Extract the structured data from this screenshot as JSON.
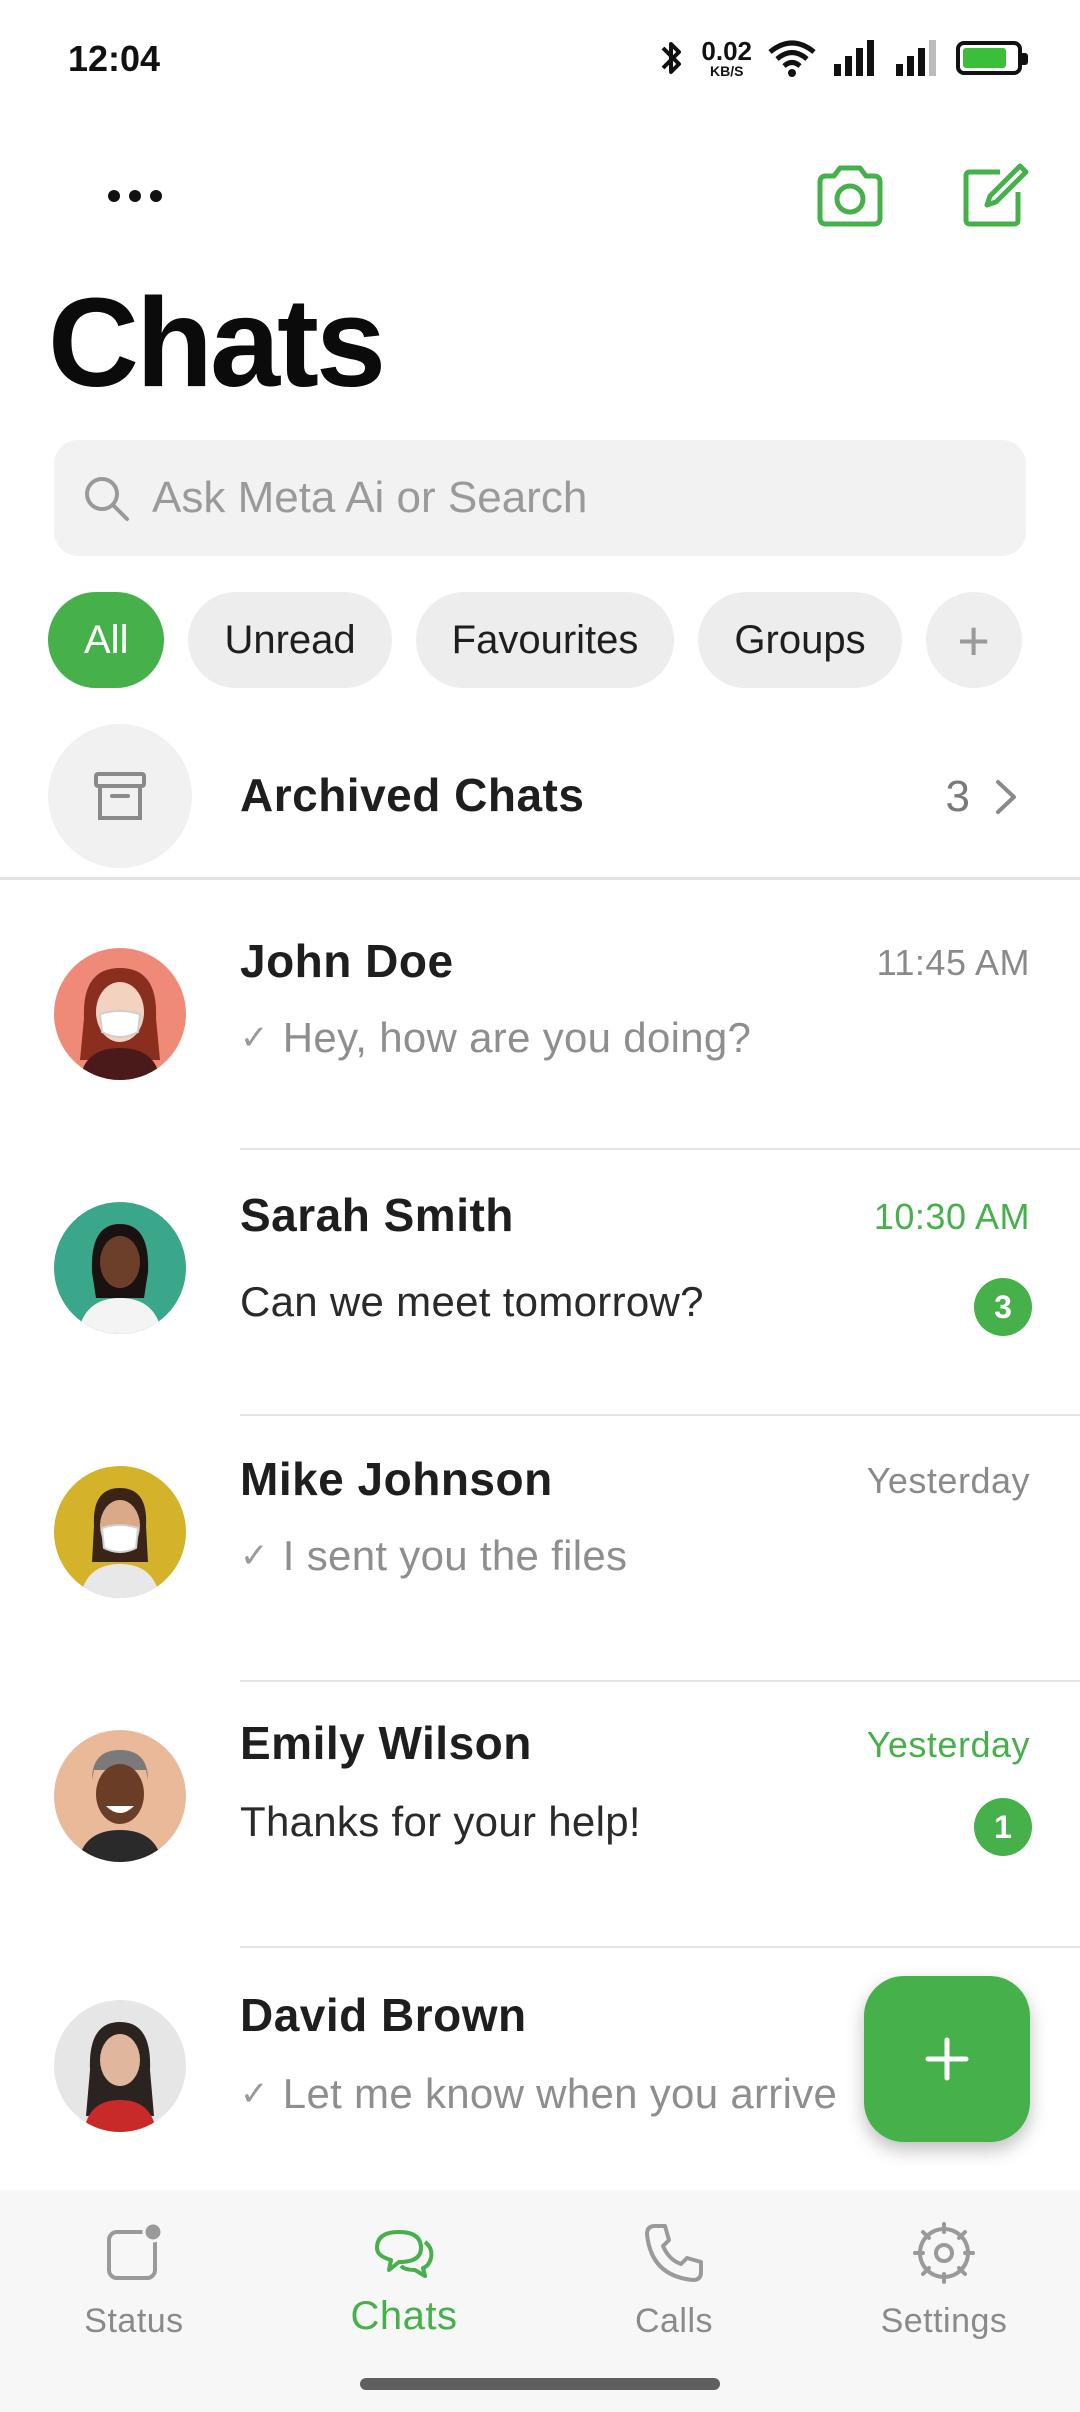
{
  "status_bar": {
    "time": "12:04",
    "net_speed_value": "0.02",
    "net_speed_unit": "KB/S",
    "battery_level": 0.85,
    "icons": [
      "bluetooth-icon",
      "wifi-icon",
      "signal-icon",
      "signal-icon-2",
      "battery-icon"
    ]
  },
  "header": {
    "title": "Chats",
    "more_icon": "more-icon",
    "camera_icon": "camera-icon",
    "compose_icon": "compose-icon"
  },
  "search": {
    "placeholder": "Ask Meta Ai or Search",
    "value": ""
  },
  "filters": [
    {
      "label": "All",
      "active": true
    },
    {
      "label": "Unread",
      "active": false
    },
    {
      "label": "Favourites",
      "active": false
    },
    {
      "label": "Groups",
      "active": false
    }
  ],
  "filters_add_label": "+",
  "archived": {
    "label": "Archived Chats",
    "count": "3"
  },
  "chats": [
    {
      "name": "John Doe",
      "time": "11:45 AM",
      "message": "Hey, how are you doing?",
      "read_tick": "✓",
      "unread_count": "",
      "unread": false
    },
    {
      "name": "Sarah Smith",
      "time": "10:30 AM",
      "message": "Can we meet tomorrow?",
      "read_tick": "",
      "unread_count": "3",
      "unread": true
    },
    {
      "name": "Mike Johnson",
      "time": "Yesterday",
      "message": "I sent you the files",
      "read_tick": "✓",
      "unread_count": "",
      "unread": false
    },
    {
      "name": "Emily Wilson",
      "time": "Yesterday",
      "message": "Thanks for your help!",
      "read_tick": "",
      "unread_count": "1",
      "unread": true
    },
    {
      "name": "David Brown",
      "time": "",
      "message": "Let me know when you arrive",
      "read_tick": "✓",
      "unread_count": "",
      "unread": false
    }
  ],
  "fab": {
    "icon": "plus-icon"
  },
  "bottom_nav": [
    {
      "label": "Status",
      "icon": "status-icon",
      "active": false
    },
    {
      "label": "Chats",
      "icon": "chats-icon",
      "active": true
    },
    {
      "label": "Calls",
      "icon": "calls-icon",
      "active": false
    },
    {
      "label": "Settings",
      "icon": "settings-icon",
      "active": false
    }
  ],
  "colors": {
    "accent": "#46b04b",
    "chip_bg": "#ededed",
    "muted_text": "#8a8a8a"
  }
}
